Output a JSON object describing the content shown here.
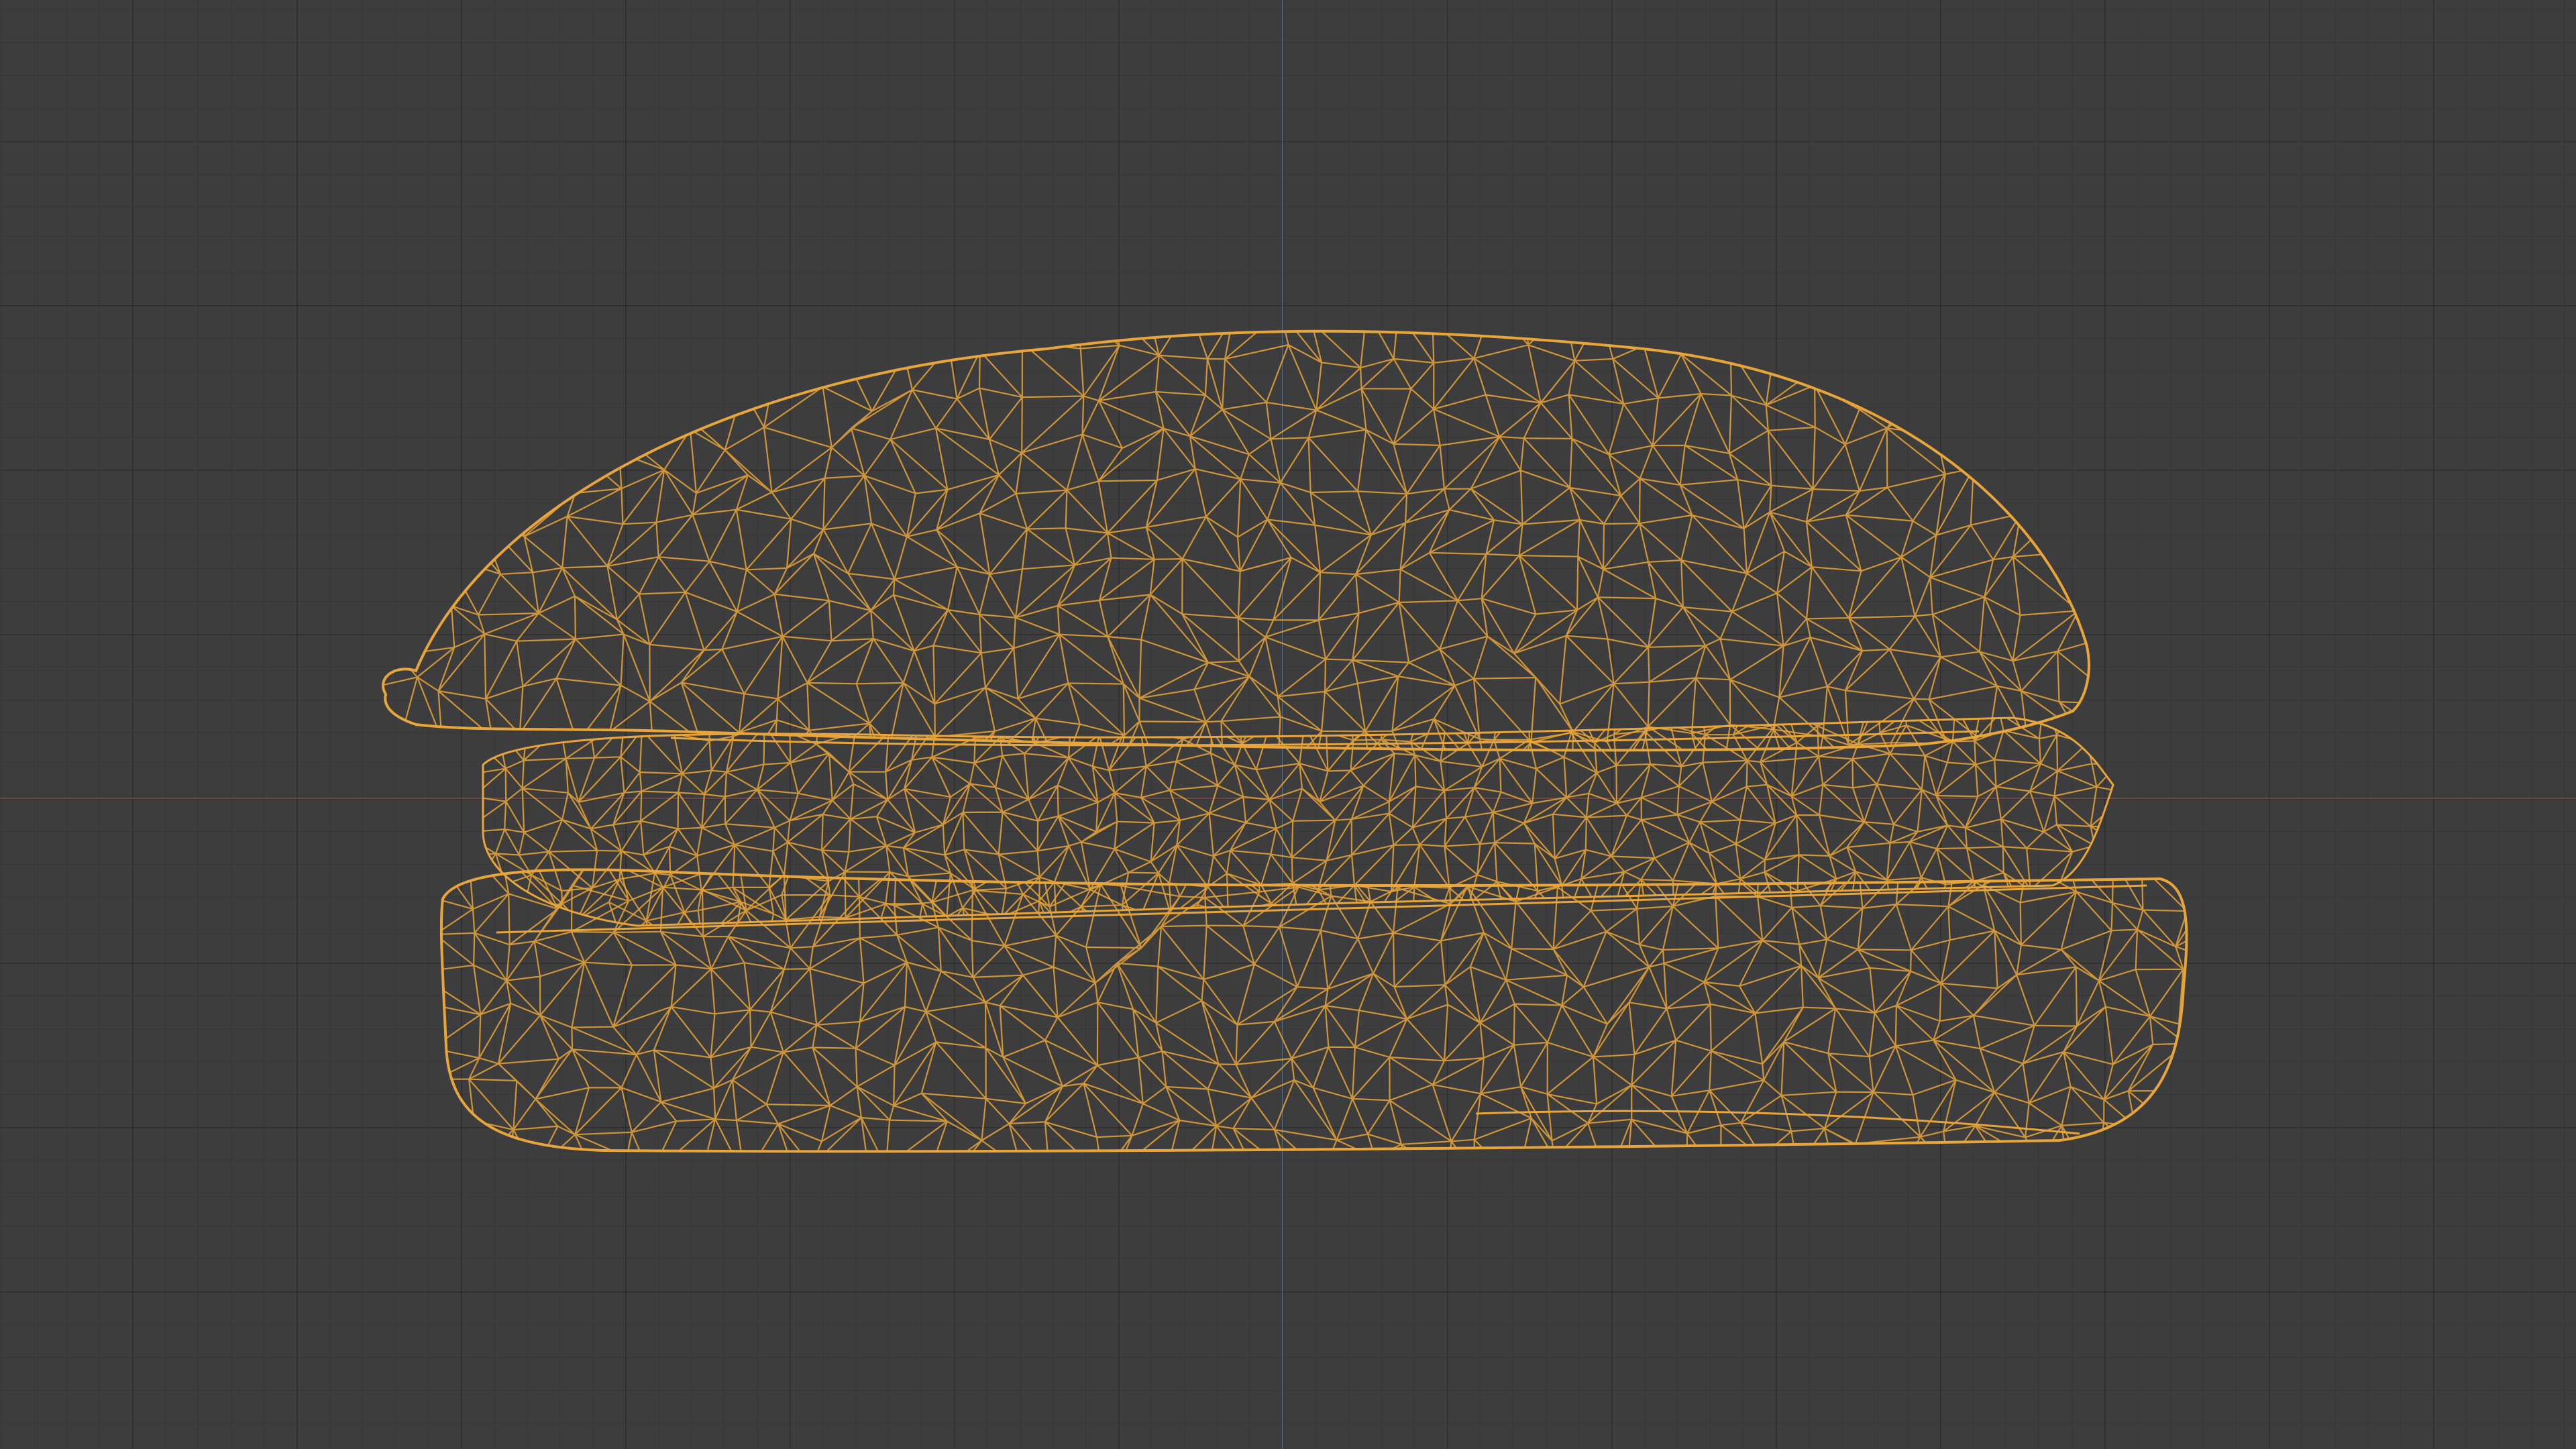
{
  "viewport": {
    "background": "#3d3d3d",
    "grid_color": "#333333",
    "x_axis_color": "#7a4a4a",
    "y_axis_color": "#4a6a8a"
  },
  "object": {
    "shading": "wireframe",
    "wire_color": "#e7a53a",
    "subject": "hamburger-mesh"
  }
}
